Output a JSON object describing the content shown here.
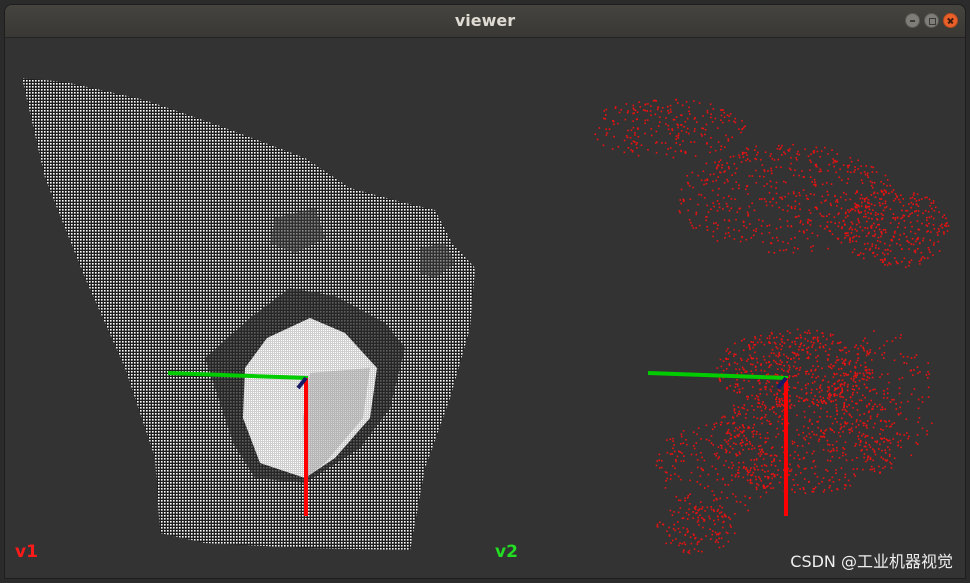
{
  "window": {
    "title": "viewer"
  },
  "viewports": [
    {
      "label": "v1",
      "label_color": "#ff1a1a",
      "cloud_color": "#ffffff"
    },
    {
      "label": "v2",
      "label_color": "#22dd22",
      "cloud_color": "#ee1111"
    }
  ],
  "axes": {
    "x_color": "#ff0000",
    "y_color": "#00cc00",
    "z_color": "#1a1a66"
  },
  "watermark": "CSDN @工业机器视觉"
}
